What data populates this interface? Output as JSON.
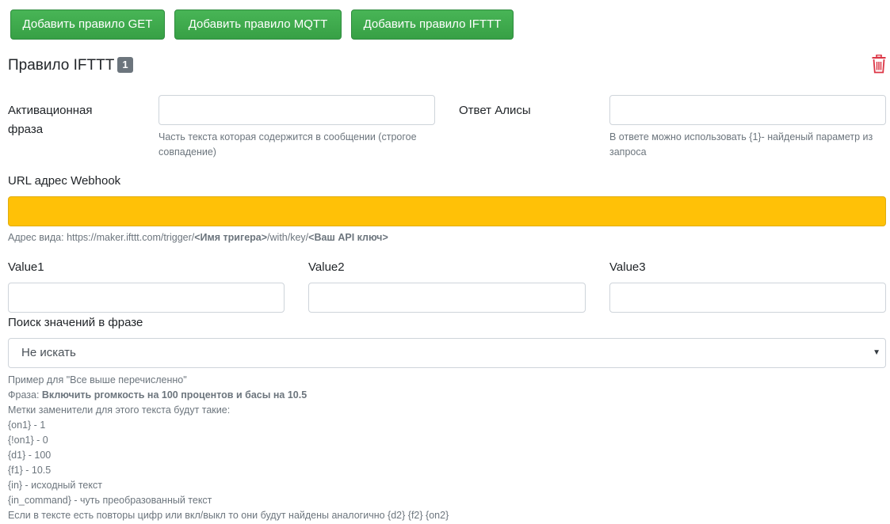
{
  "toolbar": {
    "add_get_label": "Добавить правило GET",
    "add_mqtt_label": "Добавить правило MQTT",
    "add_ifttt_label": "Добавить правило IFTTT"
  },
  "rule": {
    "title": "Правило IFTTT",
    "number": "1",
    "delete_icon": "trash-icon",
    "delete_color": "#dc3545"
  },
  "activation": {
    "label_line1": "Активационная",
    "label_line2": "фраза",
    "value": "",
    "help_line1": "Часть текста которая содержится в сообщении (строгое",
    "help_line2": "совпадение)"
  },
  "response": {
    "label": "Ответ Алисы",
    "value": "",
    "help_line1": "В ответе можно использовать {1}- найденый параметр из",
    "help_line2": "запроса"
  },
  "webhook": {
    "label": "URL адрес Webhook",
    "value": "",
    "highlight_color": "#ffc107",
    "help_prefix": "Адрес вида: https://maker.ifttt.com/trigger/",
    "help_bold1": "<Имя тригера>",
    "help_mid": "/with/key/",
    "help_bold2": "<Ваш API ключ>"
  },
  "values": {
    "value1_label": "Value1",
    "value1": "",
    "value2_label": "Value2",
    "value2": "",
    "value3_label": "Value3",
    "value3": ""
  },
  "search": {
    "label": "Поиск значений в фразе",
    "selected": "Не искать"
  },
  "example": {
    "line1": "Пример для \"Все выше перечисленно\"",
    "phrase_prefix": "Фраза: ",
    "phrase_bold": "Включить ргомкость на 100 процентов и басы на 10.5",
    "line3": "Метки заменители для этого текста будут такие:",
    "line4": "{on1} - 1",
    "line5": "{!on1} - 0",
    "line6": "{d1} - 100",
    "line7": "{f1} - 10.5",
    "line8": "{in} - исходный текст",
    "line9": "{in_command} - чуть преобразованный текст",
    "line10": "Если в тексте есть повторы цифр или вкл/выкл то они будут найдены аналогично {d2} {f2} {on2}"
  },
  "colors": {
    "button_green": "#3ea94c",
    "badge_gray": "#6c757d",
    "help_text": "#6c757d"
  }
}
